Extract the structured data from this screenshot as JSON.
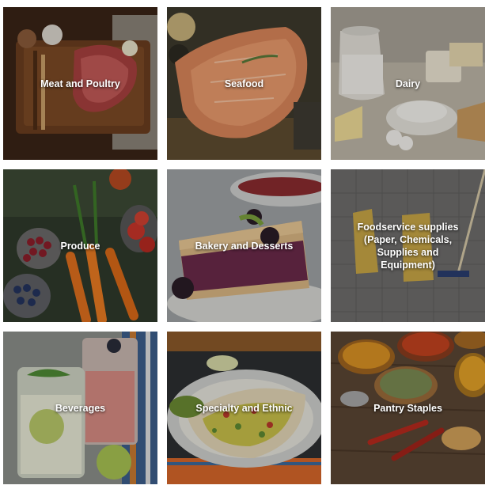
{
  "categories": [
    {
      "label": "Meat and Poultry"
    },
    {
      "label": "Seafood"
    },
    {
      "label": "Dairy"
    },
    {
      "label": "Produce"
    },
    {
      "label": "Bakery and Desserts"
    },
    {
      "label": "Foodservice supplies\n(Paper, Chemicals,\nSupplies and\nEquipment)"
    },
    {
      "label": "Beverages"
    },
    {
      "label": "Specialty and Ethnic"
    },
    {
      "label": "Pantry Staples"
    }
  ],
  "colors": {
    "label_text": "#ffffff",
    "page_background": "#ffffff"
  }
}
